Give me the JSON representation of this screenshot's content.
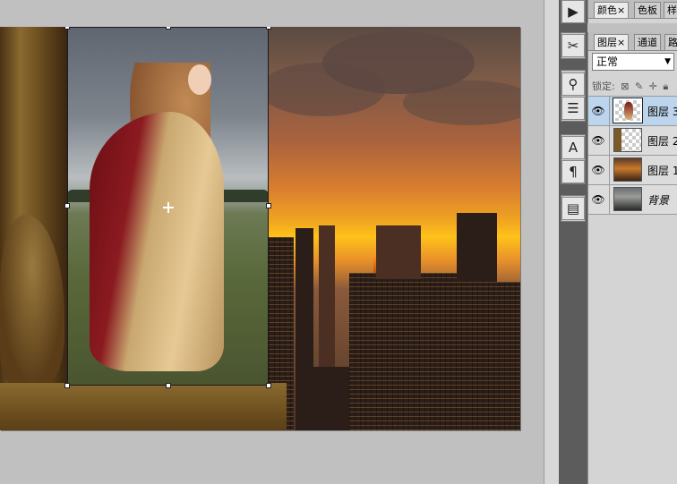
{
  "panels": {
    "top": {
      "tabs": [
        {
          "label": "颜色",
          "close": "×",
          "active": true
        },
        {
          "label": "色板",
          "close": "",
          "active": false
        },
        {
          "label": "样",
          "close": "",
          "active": false
        }
      ]
    },
    "layers_panel": {
      "tabs": [
        {
          "label": "图层",
          "close": "×",
          "active": true
        },
        {
          "label": "通道",
          "close": "",
          "active": false
        },
        {
          "label": "路",
          "close": "",
          "active": false
        }
      ],
      "blend_mode": "正常",
      "lock_label": "锁定:",
      "lock_icons": [
        "lock-transparent-icon",
        "lock-paint-icon",
        "lock-move-icon",
        "lock-all-icon"
      ],
      "layers": [
        {
          "name": "图层 3",
          "selected": true,
          "thumb": "woman"
        },
        {
          "name": "图层 2",
          "selected": false,
          "thumb": "checker-stone"
        },
        {
          "name": "图层 1",
          "selected": false,
          "thumb": "city"
        },
        {
          "name": "背景",
          "selected": false,
          "thumb": "bg"
        }
      ]
    }
  },
  "tools": [
    {
      "icon": "play-icon",
      "glyph": "▶"
    },
    {
      "icon": "brush-settings-icon",
      "glyph": "✂"
    },
    {
      "icon": "tool-presets-icon",
      "glyph": "⚲"
    },
    {
      "icon": "layer-comps-icon",
      "glyph": "☰"
    },
    {
      "icon": "character-icon",
      "glyph": "A"
    },
    {
      "icon": "paragraph-icon",
      "glyph": "¶"
    },
    {
      "icon": "notes-icon",
      "glyph": "▤"
    }
  ],
  "colors": {
    "selection": "#bcd4ec",
    "panel_bg": "#d4d4d4",
    "canvas_bg": "#c0c0c0"
  }
}
